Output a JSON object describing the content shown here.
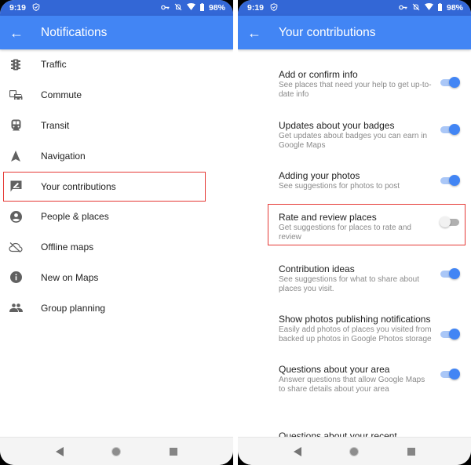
{
  "status_bar": {
    "time": "9:19",
    "battery": "98%",
    "icons": [
      "shield-icon",
      "vpn-key-icon",
      "notifications-off-icon",
      "wifi-icon",
      "battery-icon"
    ]
  },
  "left_screen": {
    "title": "Notifications",
    "back_icon": "arrow-back-icon",
    "items": [
      {
        "label": "Traffic",
        "icon": "traffic-light-icon"
      },
      {
        "label": "Commute",
        "icon": "commute-icon"
      },
      {
        "label": "Transit",
        "icon": "train-icon"
      },
      {
        "label": "Navigation",
        "icon": "navigation-arrow-icon"
      },
      {
        "label": "Your contributions",
        "icon": "rate-review-icon",
        "highlighted": true
      },
      {
        "label": "People & places",
        "icon": "account-circle-icon"
      },
      {
        "label": "Offline maps",
        "icon": "cloud-off-icon"
      },
      {
        "label": "New on Maps",
        "icon": "info-icon"
      },
      {
        "label": "Group planning",
        "icon": "people-icon"
      }
    ]
  },
  "right_screen": {
    "title": "Your contributions",
    "back_icon": "arrow-back-icon",
    "settings": [
      {
        "title": "Add or confirm info",
        "subtitle": "See places that need your help to get up-to-date info",
        "enabled": true
      },
      {
        "title": "Updates about your badges",
        "subtitle": "Get updates about badges you can earn in Google Maps",
        "enabled": true
      },
      {
        "title": "Adding your photos",
        "subtitle": "See suggestions for photos to post",
        "enabled": true
      },
      {
        "title": "Rate and review places",
        "subtitle": "Get suggestions for places to rate and review",
        "enabled": false,
        "highlighted": true
      },
      {
        "title": "Contribution ideas",
        "subtitle": "See suggestions for what to share about places you visit.",
        "enabled": true
      },
      {
        "title": "Show photos publishing notifications",
        "subtitle": "Easily add photos of places you visited from backed up photos in Google Photos storage",
        "enabled": true
      },
      {
        "title": "Questions about your area",
        "subtitle": "Answer questions that allow Google Maps to share details about your area",
        "enabled": true
      }
    ],
    "partial_item": "Questions about your recent"
  },
  "nav_bar": {
    "buttons": [
      "back-icon",
      "home-icon",
      "recents-icon"
    ]
  },
  "colors": {
    "status_bar": "#3367d6",
    "app_bar": "#4285f4",
    "toggle_on": "#4285f4",
    "highlight": "#e53935"
  }
}
